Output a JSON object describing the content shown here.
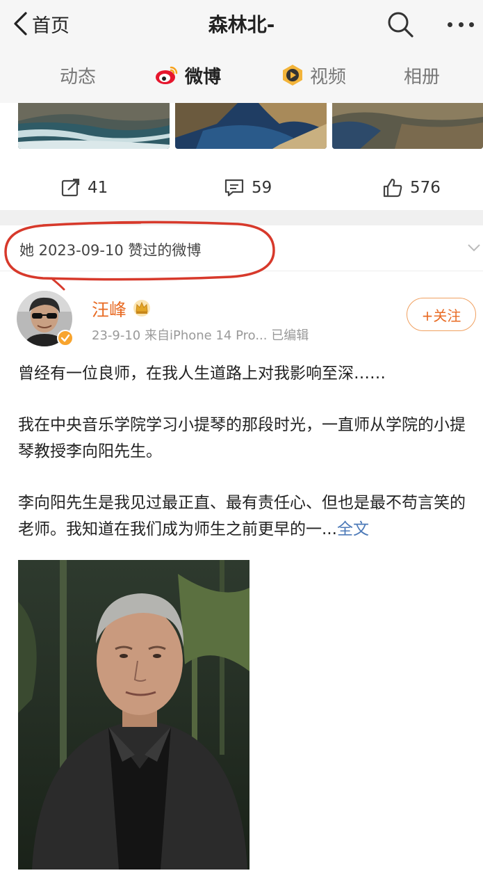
{
  "header": {
    "back_label": "首页",
    "title": "森林北-"
  },
  "tabs": [
    {
      "label": "动态",
      "active": false
    },
    {
      "label": "微博",
      "active": true,
      "icon": "weibo-icon"
    },
    {
      "label": "视频",
      "active": false,
      "icon": "video-icon"
    },
    {
      "label": "相册",
      "active": false
    }
  ],
  "prev_post": {
    "repost_count": "41",
    "comment_count": "59",
    "like_count": "576"
  },
  "liked_note": {
    "text": "她 2023-09-10 赞过的微博"
  },
  "post": {
    "author": "汪峰",
    "meta": "23-9-10  来自iPhone 14 Pro...  已编辑",
    "follow_label": "+关注",
    "paragraphs": [
      "曾经有一位良师，在我人生道路上对我影响至深……",
      "我在中央音乐学院学习小提琴的那段时光，一直师从学院的小提琴教授李向阳先生。",
      "李向阳先生是我见过最正直、最有责任心、但也是最不苟言笑的老师。我知道在我们成为师生之前更早的一..."
    ],
    "full_text_link": "全文"
  },
  "colors": {
    "accent": "#e86b24",
    "link": "#4d7ab8",
    "annotation": "#d7392b"
  }
}
